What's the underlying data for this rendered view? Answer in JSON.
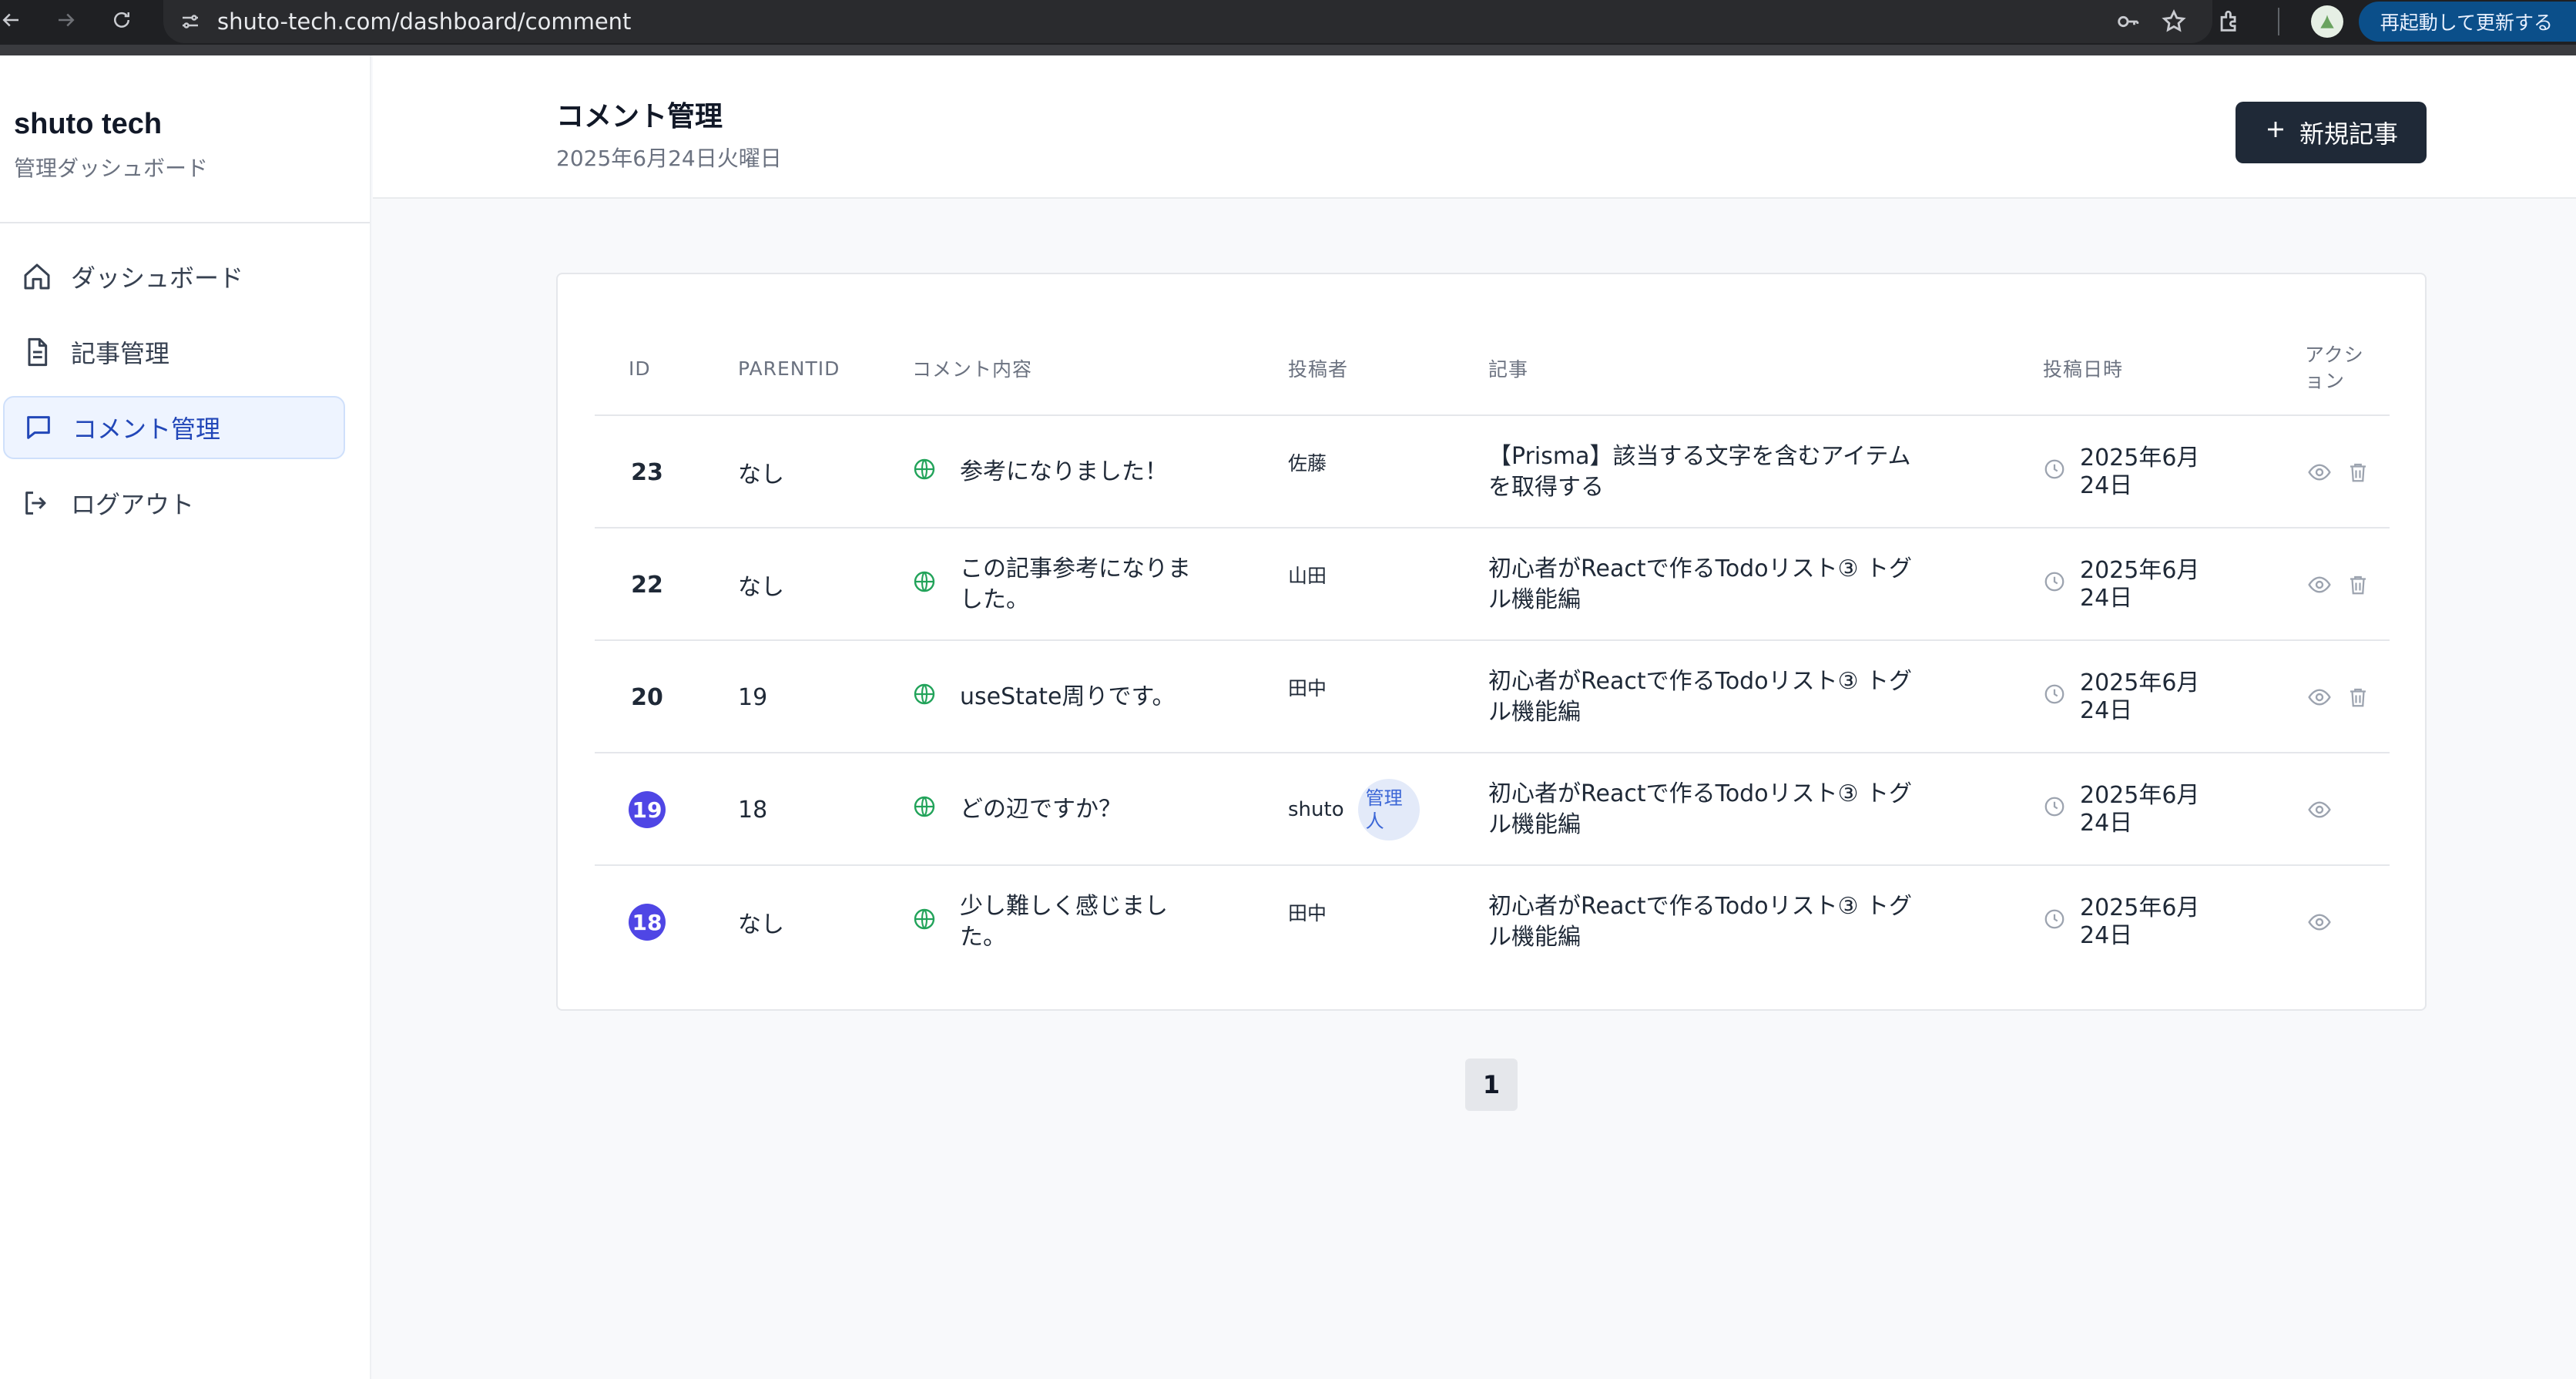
{
  "browser": {
    "url": "shuto-tech.com/dashboard/comment",
    "update_label": "再起動して更新する"
  },
  "sidebar": {
    "brand_title": "shuto tech",
    "brand_subtitle": "管理ダッシュボード",
    "items": [
      {
        "label": "ダッシュボード",
        "icon": "home-icon",
        "active": false
      },
      {
        "label": "記事管理",
        "icon": "document-icon",
        "active": false
      },
      {
        "label": "コメント管理",
        "icon": "comment-icon",
        "active": true
      },
      {
        "label": "ログアウト",
        "icon": "logout-icon",
        "active": false
      }
    ]
  },
  "header": {
    "title": "コメント管理",
    "date": "2025年6月24日火曜日",
    "new_button_label": "新規記事"
  },
  "table": {
    "columns": [
      "ID",
      "PARENTID",
      "コメント内容",
      "投稿者",
      "記事",
      "投稿日時",
      "アクション"
    ],
    "rows": [
      {
        "id": "23",
        "parent": "なし",
        "comment": "参考になりました！",
        "author": "佐藤",
        "article": "【Prisma】該当する文字を含むアイテムを取得する",
        "date": "2025年6月24日",
        "badge": false,
        "admin": false,
        "deletable": true
      },
      {
        "id": "22",
        "parent": "なし",
        "comment": "この記事参考になりました。",
        "author": "山田",
        "article": "初心者がReactで作るTodoリスト③ トグル機能編",
        "date": "2025年6月24日",
        "badge": false,
        "admin": false,
        "deletable": true
      },
      {
        "id": "20",
        "parent": "19",
        "comment": "useState周りです。",
        "author": "田中",
        "article": "初心者がReactで作るTodoリスト③ トグル機能編",
        "date": "2025年6月24日",
        "badge": false,
        "admin": false,
        "deletable": true
      },
      {
        "id": "19",
        "parent": "18",
        "comment": "どの辺ですか？",
        "author": "shuto",
        "admin_label": "管理人",
        "article": "初心者がReactで作るTodoリスト③ トグル機能編",
        "date": "2025年6月24日",
        "badge": true,
        "admin": true,
        "deletable": false
      },
      {
        "id": "18",
        "parent": "なし",
        "comment": "少し難しく感じました。",
        "author": "田中",
        "article": "初心者がReactで作るTodoリスト③ トグル機能編",
        "date": "2025年6月24日",
        "badge": true,
        "admin": false,
        "deletable": false
      }
    ]
  },
  "pagination": {
    "current": "1"
  },
  "colors": {
    "accent": "#4f46e5",
    "globe": "#22a35a",
    "primary_button": "#1f2937"
  }
}
